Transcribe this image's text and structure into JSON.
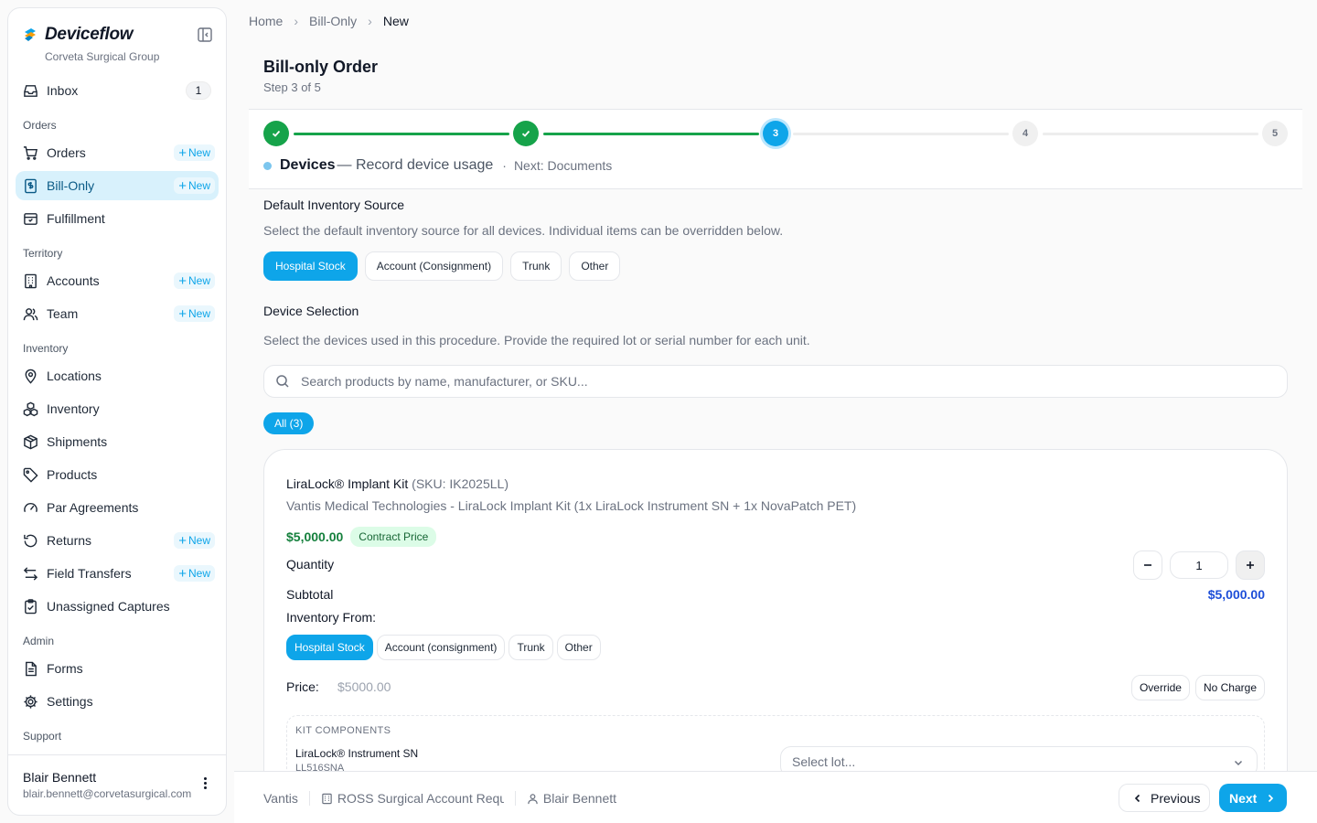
{
  "sidebar": {
    "brand": "Deviceflow",
    "org": "Corveta Surgical Group",
    "new_label": "New",
    "inbox": {
      "label": "Inbox",
      "count": "1"
    },
    "sections": {
      "orders": "Orders",
      "territory": "Territory",
      "inventory": "Inventory",
      "admin": "Admin",
      "support": "Support"
    },
    "items": {
      "orders": "Orders",
      "bill_only": "Bill-Only",
      "fulfillment": "Fulfillment",
      "accounts": "Accounts",
      "team": "Team",
      "locations": "Locations",
      "inventory": "Inventory",
      "shipments": "Shipments",
      "products": "Products",
      "par_agreements": "Par Agreements",
      "returns": "Returns",
      "field_transfers": "Field Transfers",
      "unassigned_captures": "Unassigned Captures",
      "forms": "Forms",
      "settings": "Settings"
    },
    "user": {
      "name": "Blair Bennett",
      "email": "blair.bennett@corvetasurgical.com"
    }
  },
  "breadcrumb": [
    "Home",
    "Bill-Only",
    "New"
  ],
  "page": {
    "title": "Bill-only Order",
    "step": "Step 3 of 5"
  },
  "stepper": {
    "steps": [
      "1",
      "2",
      "3",
      "4",
      "5"
    ],
    "current_name": "Devices",
    "current_desc": "— Record device usage",
    "separator": "·",
    "next": "Next: Documents"
  },
  "inventory_source": {
    "title": "Default Inventory Source",
    "desc": "Select the default inventory source for all devices. Individual items can be overridden below.",
    "options": [
      "Hospital Stock",
      "Account (Consignment)",
      "Trunk",
      "Other"
    ],
    "selected": "Hospital Stock"
  },
  "device_selection": {
    "title": "Device Selection",
    "desc": "Select the devices used in this procedure. Provide the required lot or serial number for each unit.",
    "search_placeholder": "Search products by name, manufacturer, or SKU...",
    "filter": "All (3)"
  },
  "product": {
    "name": "LiraLock® Implant Kit",
    "sku": "(SKU: IK2025LL)",
    "description": "Vantis Medical Technologies - LiraLock Implant Kit (1x LiraLock Instrument SN + 1x NovaPatch PET)",
    "price": "$5,000.00",
    "price_badge": "Contract Price",
    "quantity_label": "Quantity",
    "quantity": "1",
    "subtotal_label": "Subtotal",
    "subtotal": "$5,000.00",
    "inventory_from_label": "Inventory From:",
    "inventory_options": [
      "Hospital Stock",
      "Account (consignment)",
      "Trunk",
      "Other"
    ],
    "price_label": "Price:",
    "price_value": "$5000.00",
    "override_label": "Override",
    "no_charge_label": "No Charge",
    "kit": {
      "heading": "KIT COMPONENTS",
      "component_name": "LiraLock® Instrument SN",
      "component_code": "LL516SNA",
      "lot_placeholder": "Select lot..."
    }
  },
  "footer": {
    "manufacturer": "Vantis",
    "account": "ROSS Surgical Account Request",
    "rep": "Blair Bennett",
    "prev_label": "Previous",
    "next_label": "Next"
  },
  "colors": {
    "accent": "#0ea5e9",
    "success": "#16a34a",
    "active_nav_bg": "#d8f1fc",
    "subtotal_blue": "#1d4ed8"
  }
}
